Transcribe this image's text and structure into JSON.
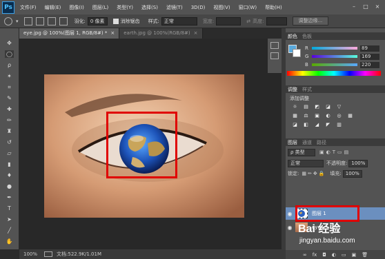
{
  "app": {
    "logo_text": "Ps"
  },
  "menu": [
    "文件(F)",
    "编辑(E)",
    "图像(I)",
    "图层(L)",
    "类型(Y)",
    "选择(S)",
    "滤镜(T)",
    "3D(D)",
    "视图(V)",
    "窗口(W)",
    "帮助(H)"
  ],
  "window_controls": [
    "–",
    "□",
    "×"
  ],
  "options": {
    "feather_label": "羽化:",
    "feather_value": "0 像素",
    "antialias_label": "消除锯齿",
    "style_label": "样式:",
    "style_value": "正常",
    "width_label": "宽度:",
    "height_label": "高度:",
    "refine_button": "调整边缘..."
  },
  "tabs": [
    {
      "label": "eye.jpg @ 100%(图层 1, RGB/8#) *",
      "close": "×"
    },
    {
      "label": "earth.jpg @ 100%(RGB/8#)",
      "close": "×"
    }
  ],
  "color_panel": {
    "tabs": [
      "颜色",
      "色板"
    ],
    "foreground": "#59a9dc",
    "background": "#ffffff",
    "r_label": "R",
    "r_value": "89",
    "g_label": "G",
    "g_value": "169",
    "b_label": "B",
    "b_value": "220"
  },
  "adjustments": {
    "tabs": [
      "调整",
      "样式"
    ],
    "title": "添加调整",
    "icons_row1": [
      "☼",
      "▤",
      "◩",
      "◪",
      "▽"
    ],
    "icons_row2": [
      "▦",
      "⚖",
      "▣",
      "◐",
      "◎",
      "▦"
    ],
    "icons_row3": [
      "◪",
      "◧",
      "◢",
      "◤",
      "▥"
    ]
  },
  "layers": {
    "tabs": [
      "图层",
      "通道",
      "路径"
    ],
    "kind_label": "ρ 类型",
    "blend_mode": "正常",
    "opacity_label": "不透明度:",
    "opacity_value": "100%",
    "lock_label": "锁定:",
    "fill_label": "填充:",
    "fill_value": "100%",
    "items": [
      {
        "name": "图层 1",
        "selected": true
      },
      {
        "name": "eye",
        "selected": false
      }
    ],
    "bottom_icons": [
      "∞",
      "fx",
      "◘",
      "◐",
      "▭",
      "▣",
      "🗑"
    ]
  },
  "status": {
    "zoom": "100%",
    "doc": "文档:522.9K/1.01M"
  },
  "watermark": {
    "brand": "Bai 经验",
    "url": "jingyan.baidu.com"
  }
}
